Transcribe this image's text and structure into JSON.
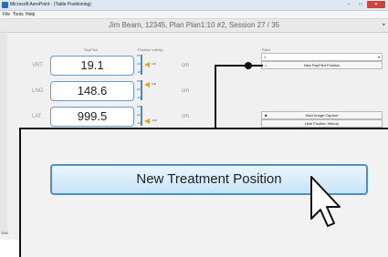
{
  "window": {
    "title": "Microsoft AeroPoint - (Table Positioning)",
    "minimize": "–",
    "maximize": "□",
    "close": "✕"
  },
  "menu": [
    {
      "label": "File"
    },
    {
      "label": "Tools"
    },
    {
      "label": "Help"
    }
  ],
  "header": {
    "session_title": "Jim Beam, 12345, Plan Plan1:10 #2, Session 27 / 35",
    "scroll_arrow": "▸"
  },
  "table": {
    "col_value": "RayPilot",
    "col_gauge": "Position validity",
    "rows": [
      {
        "label": "VRT",
        "value": "19.1",
        "unit": "cm",
        "gauge": {
          "top": "0.5",
          "mid": "0.0",
          "bot": "-0.5",
          "pointer_label": "0.02"
        }
      },
      {
        "label": "LNG",
        "value": "148.6",
        "unit": "cm",
        "gauge": {
          "top": "0.5",
          "mid": "0.0",
          "bot": "-0.5",
          "pointer_label": "0.36"
        }
      },
      {
        "label": "LAT",
        "value": "999.5",
        "unit": "cm",
        "gauge": {
          "top": "0.5",
          "mid": "0.0",
          "bot": "-0.5",
          "pointer_label": "-0.39"
        }
      }
    ]
  },
  "right_panel": {
    "field_label": "Field",
    "field_value": "1",
    "field_arrow": "▾",
    "new_position_button": "New RayPilot Position",
    "start_capture_button": "Start Image Capture",
    "hide_history_button": "Hide Position History",
    "icons": {
      "new_position": "⌂",
      "capture": "◙"
    }
  },
  "zoom": {
    "new_treatment_button": "New Treatment Position"
  },
  "footer": {
    "label": "Exit"
  }
}
